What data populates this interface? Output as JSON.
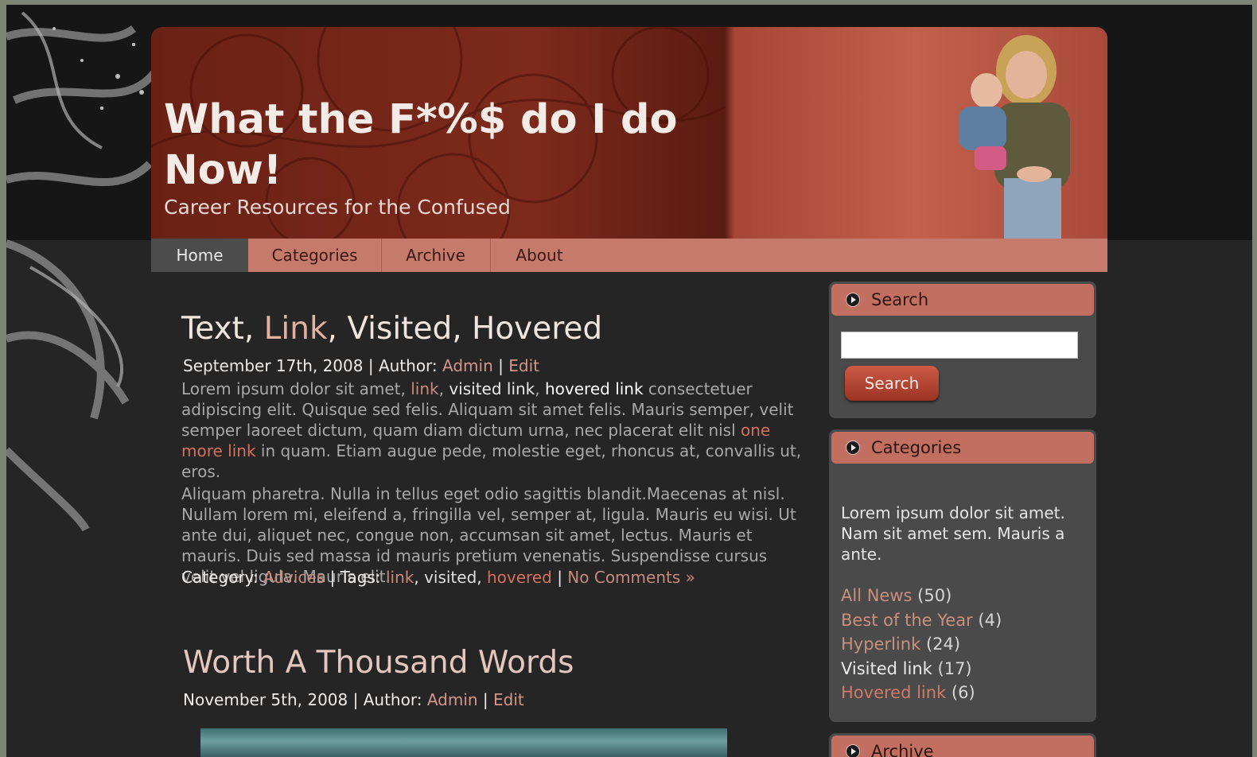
{
  "site": {
    "title": "What the F*%$ do I do Now!",
    "subtitle": "Career Resources for the Confused"
  },
  "nav": [
    {
      "label": "Home",
      "active": true
    },
    {
      "label": "Categories",
      "active": false
    },
    {
      "label": "Archive",
      "active": false
    },
    {
      "label": "About",
      "active": false
    }
  ],
  "posts": [
    {
      "title_parts": [
        "Text, ",
        "Link",
        ", Visited, Hovered"
      ],
      "date": "September 17th, 2008",
      "author_label": "Author:",
      "author": "Admin",
      "edit": "Edit",
      "p1": {
        "a": "Lorem ipsum dolor sit amet, ",
        "link": "link",
        "b": ", ",
        "visited": "visited link",
        "c": ", ",
        "hovered": "hovered link",
        "d": " consectetuer adipiscing elit. Quisque sed felis. Aliquam sit amet felis. Mauris semper, velit semper laoreet dictum, quam diam dictum urna, nec placerat elit nisl ",
        "more": "one more link",
        "e": " in quam. Etiam augue pede, molestie eget, rhoncus at, convallis ut, eros."
      },
      "p2": "Aliquam pharetra. Nulla in tellus eget odio sagittis blandit.Maecenas at nisl. Nullam lorem mi, eleifend a, fringilla vel, semper at, ligula. Mauris eu wisi. Ut ante dui, aliquet nec, congue non, accumsan sit amet, lectus. Mauris et mauris. Duis sed massa id mauris pretium venenatis. Suspendisse cursus velit vel ligula. Mauris elit.",
      "category_label": "Category:",
      "category": "Advices",
      "tags_label": "Tags:",
      "tags": [
        "link",
        "visited",
        "hovered"
      ],
      "comments": "No Comments »"
    },
    {
      "title": "Worth A Thousand Words",
      "date": "November 5th, 2008",
      "author_label": "Author:",
      "author": "Admin",
      "edit": "Edit"
    }
  ],
  "sidebar": {
    "search": {
      "title": "Search",
      "button": "Search",
      "value": ""
    },
    "categories": {
      "title": "Categories",
      "description": "Lorem ipsum dolor sit amet. Nam sit amet sem. Mauris a ante.",
      "items": [
        {
          "label": "All News",
          "count": "(50)"
        },
        {
          "label": "Best of the Year",
          "count": "(4)"
        },
        {
          "label": "Hyperlink",
          "count": "(24)"
        },
        {
          "label": "Visited link",
          "count": "(17)"
        },
        {
          "label": "Hovered link",
          "count": "(6)"
        }
      ]
    },
    "archive": {
      "title": "Archive"
    }
  },
  "colors": {
    "header_red": "#7d2a1c",
    "nav_bar": "#c57a6c",
    "link": "#c98a7d",
    "hover": "#d4705e",
    "background": "#252525"
  }
}
